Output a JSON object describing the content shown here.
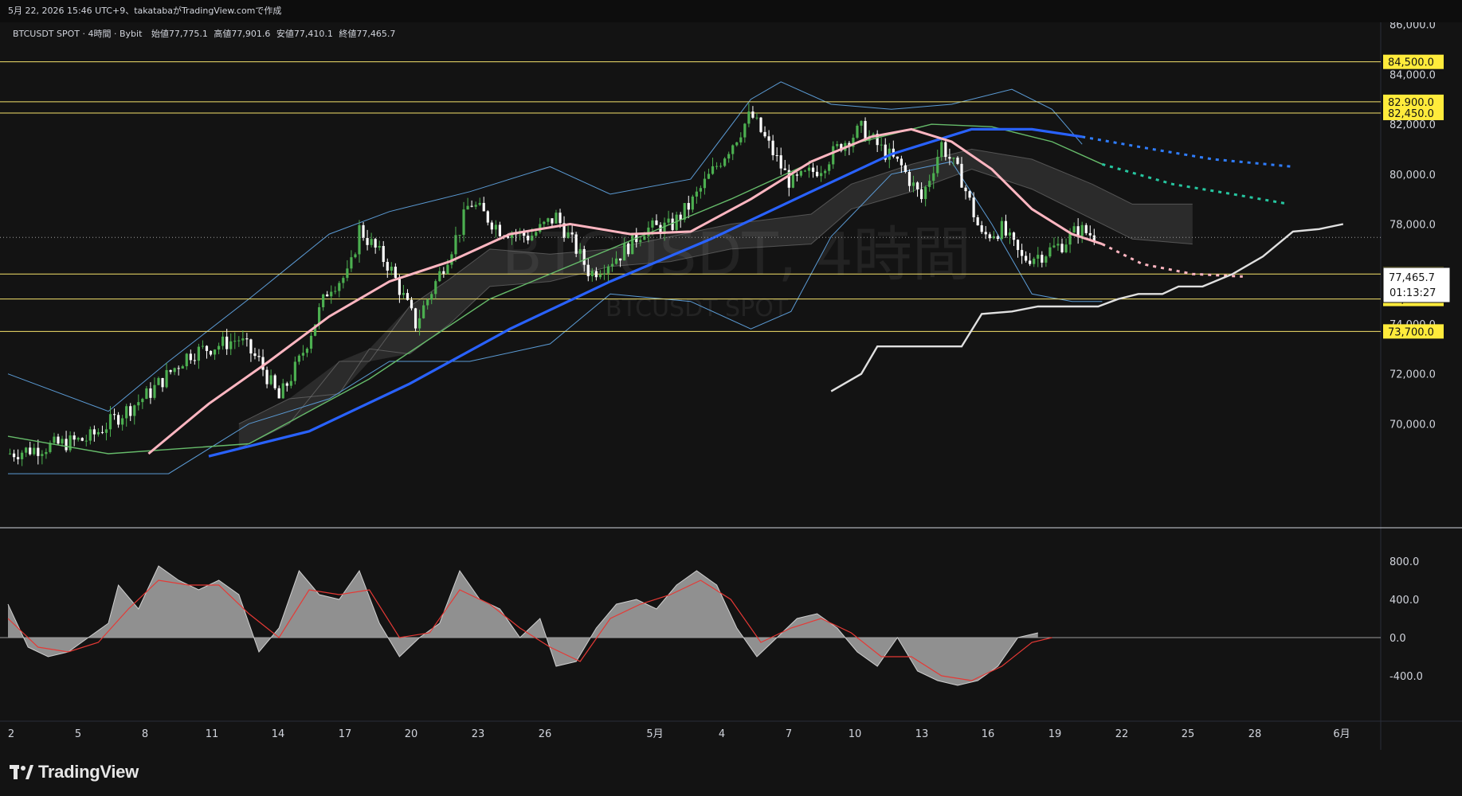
{
  "header": {
    "caption": "5月 22, 2026 15:46 UTC+9、takatabaがTradingView.comで作成"
  },
  "legend": {
    "symbol": "BTCUSDT SPOT · 4時間 · Bybit",
    "open_label": "始値",
    "open": "77,775.1",
    "high_label": "高値",
    "high": "77,901.6",
    "low_label": "安値",
    "low": "77,410.1",
    "close_label": "終値",
    "close": "77,465.7"
  },
  "watermark": {
    "title": "BTCUSDT, 4時間",
    "subtitle": "BTCUSDT SPOT"
  },
  "price_tag": {
    "price": "77,465.7",
    "countdown": "01:13:27"
  },
  "brand": {
    "name": "TradingView"
  },
  "colors": {
    "background": "#131313",
    "candle_up": "#4caf50",
    "candle_down": "#ffffff",
    "sma_fast": "#ffb6c1",
    "sma_slow": "#2962ff",
    "sma_mid": "#66bb6a",
    "bollinger": "#5b9bd5",
    "horizontal_line": "#f5e26b",
    "level_label_bg": "#ffeb3b",
    "macd_fill": "#9e9e9e",
    "macd_signal": "#e53935"
  },
  "chart_data": [
    {
      "type": "candlestick",
      "title": "BTCUSDT SPOT · 4時間 · Bybit",
      "ylim": [
        68500,
        87000
      ],
      "y_ticks": [
        "70,000.0",
        "72,000.0",
        "74,000.0",
        "76,000.0",
        "78,000.0",
        "80,000.0",
        "82,000.0",
        "84,000.0",
        "86,000.0"
      ],
      "x_ticks": [
        "2",
        "5",
        "8",
        "11",
        "14",
        "17",
        "20",
        "23",
        "26",
        "5月",
        "4",
        "7",
        "10",
        "13",
        "16",
        "19",
        "22",
        "25",
        "28",
        "6月"
      ],
      "horizontal_levels": [
        {
          "value": 84500,
          "label": "84,500.0"
        },
        {
          "value": 82900,
          "label": "82,900.0"
        },
        {
          "value": 82450,
          "label": "82,450.0"
        },
        {
          "value": 76000,
          "label": "76,000.0"
        },
        {
          "value": 75000,
          "label": "75,000.0"
        },
        {
          "value": 73700,
          "label": "73,700.0"
        }
      ],
      "last_price": 77465.7,
      "price_path": [
        {
          "x": 0,
          "y": 68800
        },
        {
          "x": 4,
          "y": 69400
        },
        {
          "x": 7,
          "y": 71200
        },
        {
          "x": 9,
          "y": 72800
        },
        {
          "x": 11.5,
          "y": 73400
        },
        {
          "x": 12.5,
          "y": 72500
        },
        {
          "x": 13.5,
          "y": 71000
        },
        {
          "x": 14.5,
          "y": 72500
        },
        {
          "x": 16,
          "y": 75500
        },
        {
          "x": 17,
          "y": 76000
        },
        {
          "x": 17.5,
          "y": 77800
        },
        {
          "x": 19,
          "y": 76300
        },
        {
          "x": 20.3,
          "y": 74000
        },
        {
          "x": 21.5,
          "y": 76000
        },
        {
          "x": 22.5,
          "y": 77800
        },
        {
          "x": 23,
          "y": 78900
        },
        {
          "x": 24.5,
          "y": 77800
        },
        {
          "x": 26,
          "y": 77500
        },
        {
          "x": 27.3,
          "y": 78300
        },
        {
          "x": 28.3,
          "y": 77000
        },
        {
          "x": 29,
          "y": 76000
        },
        {
          "x": 30.5,
          "y": 76800
        },
        {
          "x": 31.7,
          "y": 77800
        },
        {
          "x": 33,
          "y": 77900
        },
        {
          "x": 34,
          "y": 78800
        },
        {
          "x": 35,
          "y": 80000
        },
        {
          "x": 36.3,
          "y": 81500
        },
        {
          "x": 37,
          "y": 82400
        },
        {
          "x": 38,
          "y": 81000
        },
        {
          "x": 39,
          "y": 79600
        },
        {
          "x": 40.5,
          "y": 80300
        },
        {
          "x": 41.5,
          "y": 81200
        },
        {
          "x": 42.5,
          "y": 81800
        },
        {
          "x": 43.5,
          "y": 81000
        },
        {
          "x": 44.5,
          "y": 80300
        },
        {
          "x": 45.5,
          "y": 79000
        },
        {
          "x": 46.5,
          "y": 81200
        },
        {
          "x": 47.5,
          "y": 79800
        },
        {
          "x": 48.5,
          "y": 77500
        },
        {
          "x": 49.5,
          "y": 77800
        },
        {
          "x": 50.5,
          "y": 76600
        },
        {
          "x": 51.5,
          "y": 76800
        },
        {
          "x": 52.5,
          "y": 77200
        },
        {
          "x": 53.3,
          "y": 77800
        },
        {
          "x": 54.3,
          "y": 77465.7
        }
      ],
      "sma_fast_path": [
        {
          "x": 7,
          "y": 68800
        },
        {
          "x": 10,
          "y": 70800
        },
        {
          "x": 13,
          "y": 72500
        },
        {
          "x": 16,
          "y": 74300
        },
        {
          "x": 19,
          "y": 75700
        },
        {
          "x": 22,
          "y": 76500
        },
        {
          "x": 25,
          "y": 77600
        },
        {
          "x": 28,
          "y": 78000
        },
        {
          "x": 31,
          "y": 77600
        },
        {
          "x": 34,
          "y": 77700
        },
        {
          "x": 37,
          "y": 79000
        },
        {
          "x": 40,
          "y": 80500
        },
        {
          "x": 43,
          "y": 81500
        },
        {
          "x": 45,
          "y": 81800
        },
        {
          "x": 47,
          "y": 81300
        },
        {
          "x": 49,
          "y": 80200
        },
        {
          "x": 51,
          "y": 78600
        },
        {
          "x": 53,
          "y": 77600
        },
        {
          "x": 54.5,
          "y": 77200
        }
      ],
      "sma_fast_projection": [
        {
          "x": 54.5,
          "y": 77200
        },
        {
          "x": 56.5,
          "y": 76400
        },
        {
          "x": 59,
          "y": 76000
        },
        {
          "x": 61.5,
          "y": 75900
        }
      ],
      "sma_slow_path": [
        {
          "x": 10,
          "y": 68700
        },
        {
          "x": 15,
          "y": 69700
        },
        {
          "x": 20,
          "y": 71600
        },
        {
          "x": 25,
          "y": 73800
        },
        {
          "x": 30,
          "y": 75700
        },
        {
          "x": 35,
          "y": 77400
        },
        {
          "x": 40,
          "y": 79300
        },
        {
          "x": 44,
          "y": 80800
        },
        {
          "x": 48,
          "y": 81800
        },
        {
          "x": 51,
          "y": 81800
        },
        {
          "x": 53.5,
          "y": 81500
        }
      ],
      "sma_slow_projection": [
        {
          "x": 53.5,
          "y": 81500
        },
        {
          "x": 57,
          "y": 81000
        },
        {
          "x": 60,
          "y": 80600
        },
        {
          "x": 64,
          "y": 80300
        }
      ],
      "sma_mid_path": [
        {
          "x": 0,
          "y": 69500
        },
        {
          "x": 5,
          "y": 68800
        },
        {
          "x": 12,
          "y": 69200
        },
        {
          "x": 18,
          "y": 71800
        },
        {
          "x": 24,
          "y": 75000
        },
        {
          "x": 30,
          "y": 77000
        },
        {
          "x": 36,
          "y": 79000
        },
        {
          "x": 42,
          "y": 81200
        },
        {
          "x": 46,
          "y": 82000
        },
        {
          "x": 49,
          "y": 81900
        },
        {
          "x": 52,
          "y": 81300
        },
        {
          "x": 54.5,
          "y": 80400
        }
      ],
      "sma_mid_projection": [
        {
          "x": 54.5,
          "y": 80400
        },
        {
          "x": 58,
          "y": 79600
        },
        {
          "x": 61,
          "y": 79200
        },
        {
          "x": 63.8,
          "y": 78800
        }
      ],
      "bollinger_upper": [
        {
          "x": 0,
          "y": 72000
        },
        {
          "x": 5,
          "y": 70500
        },
        {
          "x": 8,
          "y": 72500
        },
        {
          "x": 12,
          "y": 75000
        },
        {
          "x": 16,
          "y": 77600
        },
        {
          "x": 19,
          "y": 78500
        },
        {
          "x": 23,
          "y": 79300
        },
        {
          "x": 27,
          "y": 80300
        },
        {
          "x": 30,
          "y": 79200
        },
        {
          "x": 34,
          "y": 79800
        },
        {
          "x": 37,
          "y": 83000
        },
        {
          "x": 38.5,
          "y": 83700
        },
        {
          "x": 41,
          "y": 82800
        },
        {
          "x": 44,
          "y": 82600
        },
        {
          "x": 47,
          "y": 82800
        },
        {
          "x": 50,
          "y": 83400
        },
        {
          "x": 52,
          "y": 82600
        },
        {
          "x": 53.5,
          "y": 81200
        }
      ],
      "bollinger_lower": [
        {
          "x": 0,
          "y": 68000
        },
        {
          "x": 8,
          "y": 68000
        },
        {
          "x": 12,
          "y": 70000
        },
        {
          "x": 16,
          "y": 71000
        },
        {
          "x": 19,
          "y": 72500
        },
        {
          "x": 23,
          "y": 72500
        },
        {
          "x": 27,
          "y": 73200
        },
        {
          "x": 30,
          "y": 75200
        },
        {
          "x": 34,
          "y": 74900
        },
        {
          "x": 37,
          "y": 73800
        },
        {
          "x": 39,
          "y": 74500
        },
        {
          "x": 41,
          "y": 77500
        },
        {
          "x": 44,
          "y": 80000
        },
        {
          "x": 47,
          "y": 80500
        },
        {
          "x": 49,
          "y": 78000
        },
        {
          "x": 51,
          "y": 75200
        },
        {
          "x": 53,
          "y": 74900
        },
        {
          "x": 54.5,
          "y": 74900
        }
      ],
      "support_line": [
        {
          "x": 41,
          "y": 71300
        },
        {
          "x": 42.5,
          "y": 72000
        },
        {
          "x": 43.3,
          "y": 73100
        },
        {
          "x": 47.5,
          "y": 73100
        },
        {
          "x": 48.5,
          "y": 74400
        },
        {
          "x": 50,
          "y": 74500
        },
        {
          "x": 51.3,
          "y": 74700
        },
        {
          "x": 54.3,
          "y": 74700
        },
        {
          "x": 55.3,
          "y": 75000
        },
        {
          "x": 56.3,
          "y": 75200
        },
        {
          "x": 57.5,
          "y": 75200
        },
        {
          "x": 58.3,
          "y": 75500
        },
        {
          "x": 59.5,
          "y": 75500
        },
        {
          "x": 61,
          "y": 76000
        },
        {
          "x": 62.5,
          "y": 76700
        },
        {
          "x": 64,
          "y": 77700
        },
        {
          "x": 65.3,
          "y": 77800
        },
        {
          "x": 66.5,
          "y": 78000
        }
      ],
      "cloud": [
        {
          "x": 11.5,
          "y1": 69000,
          "y2": 70000
        },
        {
          "x": 14,
          "y1": 70000,
          "y2": 71000
        },
        {
          "x": 16.5,
          "y1": 72500,
          "y2": 71200
        },
        {
          "x": 18,
          "y1": 72500,
          "y2": 73000
        },
        {
          "x": 20,
          "y1": 74700,
          "y2": 72800
        },
        {
          "x": 22,
          "y1": 75800,
          "y2": 74000
        },
        {
          "x": 24,
          "y1": 77000,
          "y2": 75500
        },
        {
          "x": 27,
          "y1": 76800,
          "y2": 75700
        },
        {
          "x": 30,
          "y1": 77000,
          "y2": 76300
        },
        {
          "x": 33,
          "y1": 77500,
          "y2": 76500
        },
        {
          "x": 36,
          "y1": 78000,
          "y2": 77000
        },
        {
          "x": 40,
          "y1": 78400,
          "y2": 77200
        },
        {
          "x": 42,
          "y1": 79600,
          "y2": 78600
        },
        {
          "x": 45,
          "y1": 80400,
          "y2": 79300
        },
        {
          "x": 48,
          "y1": 81000,
          "y2": 80200
        },
        {
          "x": 51,
          "y1": 80600,
          "y2": 79400
        },
        {
          "x": 54,
          "y1": 79600,
          "y2": 78200
        },
        {
          "x": 56,
          "y1": 78800,
          "y2": 77400
        },
        {
          "x": 59,
          "y1": 78800,
          "y2": 77200
        }
      ]
    },
    {
      "type": "area",
      "title": "",
      "ylim": [
        -700,
        900
      ],
      "y_ticks": [
        "800.0",
        "400.0",
        "0.0",
        "-400.0"
      ],
      "histogram_path": [
        {
          "x": 0,
          "y": 350
        },
        {
          "x": 1,
          "y": -100
        },
        {
          "x": 2,
          "y": -200
        },
        {
          "x": 3,
          "y": -150
        },
        {
          "x": 4,
          "y": 0
        },
        {
          "x": 5,
          "y": 150
        },
        {
          "x": 5.5,
          "y": 550
        },
        {
          "x": 6.5,
          "y": 300
        },
        {
          "x": 7.5,
          "y": 750
        },
        {
          "x": 8.5,
          "y": 600
        },
        {
          "x": 9.5,
          "y": 500
        },
        {
          "x": 10.5,
          "y": 600
        },
        {
          "x": 11.5,
          "y": 450
        },
        {
          "x": 12.5,
          "y": -150
        },
        {
          "x": 13.5,
          "y": 100
        },
        {
          "x": 14.5,
          "y": 700
        },
        {
          "x": 15.5,
          "y": 450
        },
        {
          "x": 16.5,
          "y": 400
        },
        {
          "x": 17.5,
          "y": 700
        },
        {
          "x": 18.5,
          "y": 150
        },
        {
          "x": 19.5,
          "y": -200
        },
        {
          "x": 20.5,
          "y": 0
        },
        {
          "x": 21.5,
          "y": 150
        },
        {
          "x": 22.5,
          "y": 700
        },
        {
          "x": 23.5,
          "y": 400
        },
        {
          "x": 24.5,
          "y": 300
        },
        {
          "x": 25.5,
          "y": 0
        },
        {
          "x": 26.5,
          "y": 200
        },
        {
          "x": 27.3,
          "y": -300
        },
        {
          "x": 28.3,
          "y": -250
        },
        {
          "x": 29.3,
          "y": 100
        },
        {
          "x": 30.3,
          "y": 350
        },
        {
          "x": 31.3,
          "y": 400
        },
        {
          "x": 32.3,
          "y": 300
        },
        {
          "x": 33.3,
          "y": 550
        },
        {
          "x": 34.3,
          "y": 700
        },
        {
          "x": 35.3,
          "y": 550
        },
        {
          "x": 36.3,
          "y": 100
        },
        {
          "x": 37.3,
          "y": -200
        },
        {
          "x": 38.3,
          "y": 0
        },
        {
          "x": 39.3,
          "y": 200
        },
        {
          "x": 40.3,
          "y": 250
        },
        {
          "x": 41.3,
          "y": 100
        },
        {
          "x": 42.3,
          "y": -150
        },
        {
          "x": 43.3,
          "y": -300
        },
        {
          "x": 44.3,
          "y": 0
        },
        {
          "x": 45.3,
          "y": -350
        },
        {
          "x": 46.3,
          "y": -450
        },
        {
          "x": 47.3,
          "y": -500
        },
        {
          "x": 48.3,
          "y": -450
        },
        {
          "x": 49.3,
          "y": -300
        },
        {
          "x": 50.3,
          "y": 0
        },
        {
          "x": 51.3,
          "y": 50
        }
      ],
      "signal_path": [
        {
          "x": 0,
          "y": 200
        },
        {
          "x": 1.5,
          "y": -100
        },
        {
          "x": 3,
          "y": -150
        },
        {
          "x": 4.5,
          "y": -50
        },
        {
          "x": 6,
          "y": 300
        },
        {
          "x": 7.5,
          "y": 600
        },
        {
          "x": 9,
          "y": 550
        },
        {
          "x": 10.5,
          "y": 550
        },
        {
          "x": 12,
          "y": 250
        },
        {
          "x": 13.5,
          "y": 0
        },
        {
          "x": 15,
          "y": 500
        },
        {
          "x": 16.5,
          "y": 450
        },
        {
          "x": 18,
          "y": 500
        },
        {
          "x": 19.5,
          "y": 0
        },
        {
          "x": 21,
          "y": 50
        },
        {
          "x": 22.5,
          "y": 500
        },
        {
          "x": 24,
          "y": 350
        },
        {
          "x": 25.5,
          "y": 100
        },
        {
          "x": 27,
          "y": -100
        },
        {
          "x": 28.5,
          "y": -250
        },
        {
          "x": 30,
          "y": 200
        },
        {
          "x": 31.5,
          "y": 350
        },
        {
          "x": 33,
          "y": 450
        },
        {
          "x": 34.5,
          "y": 600
        },
        {
          "x": 36,
          "y": 400
        },
        {
          "x": 37.5,
          "y": -50
        },
        {
          "x": 39,
          "y": 100
        },
        {
          "x": 40.5,
          "y": 200
        },
        {
          "x": 42,
          "y": 50
        },
        {
          "x": 43.5,
          "y": -200
        },
        {
          "x": 45,
          "y": -200
        },
        {
          "x": 46.5,
          "y": -400
        },
        {
          "x": 48,
          "y": -450
        },
        {
          "x": 49.5,
          "y": -300
        },
        {
          "x": 51,
          "y": -50
        },
        {
          "x": 52,
          "y": 0
        }
      ]
    }
  ]
}
